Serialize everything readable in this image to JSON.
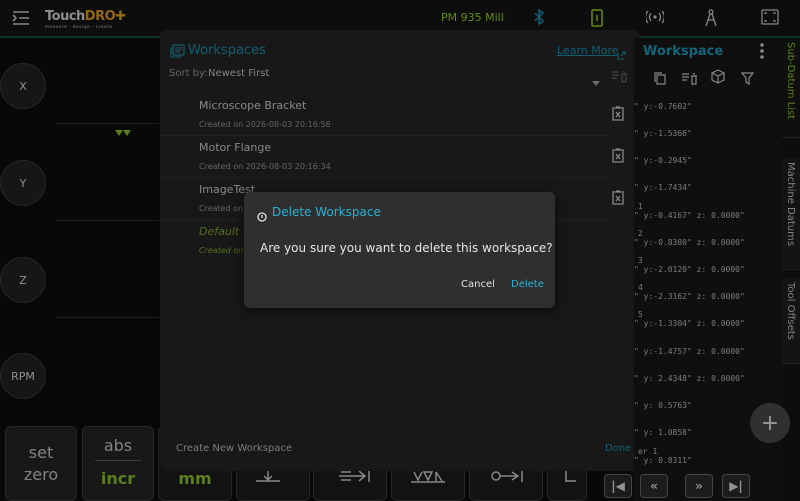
{
  "topbar": {
    "logo_main": "Touch",
    "logo_accent": "DRO",
    "logo_tag": "measure · design · create",
    "machine": "PM 935 Mill"
  },
  "axes": {
    "x": "X",
    "y": "Y",
    "z": "Z",
    "rpm": "RPM"
  },
  "bottom_buttons": {
    "set": "set",
    "zero": "zero",
    "abs": "abs",
    "incr": "incr",
    "mm": "mm"
  },
  "workspaces": {
    "title": "Workspaces",
    "learn_more": "Learn More",
    "sort_label": "Sort by:",
    "sort_value": "Newest First",
    "items": [
      {
        "name": "Microscope Bracket",
        "created": "Created on 2026-08-03 20:16:56"
      },
      {
        "name": "Motor Flange",
        "created": "Created on 2026-08-03 20:16:34"
      },
      {
        "name": "ImageTest",
        "created": "Created on 2"
      },
      {
        "name": "Default Wo",
        "created": "Created on 2"
      }
    ],
    "create_new": "Create New Workspace",
    "done": "Done"
  },
  "right_panel": {
    "title": "Workspace",
    "rows": [
      {
        "idx": "",
        "text": "\" y:-0.7602\""
      },
      {
        "idx": "",
        "text": "\" y:-1.5366\""
      },
      {
        "idx": "",
        "text": "\" y:-0.2945\""
      },
      {
        "idx": "",
        "text": "\" y:-1.7434\""
      },
      {
        "idx": "1",
        "text": "\" y:-0.4167\" z: 0.0000\""
      },
      {
        "idx": "2",
        "text": "\" y:-0.8380\" z: 0.0000\""
      },
      {
        "idx": "3",
        "text": "\" y:-2.0120\" z: 0.0000\""
      },
      {
        "idx": "4",
        "text": "\" y:-2.3162\" z: 0.0000\""
      },
      {
        "idx": "5",
        "text": "\" y:-1.3304\" z: 0.0000\""
      },
      {
        "idx": "",
        "text": "\" y:-1.4757\" z: 0.0000\""
      },
      {
        "idx": "",
        "text": "\" y: 2.4348\" z: 0.0000\""
      },
      {
        "idx": "",
        "text": "\" y: 0.5763\""
      },
      {
        "idx": "",
        "text": "\" y: 1.0858\""
      },
      {
        "idx": "er 1",
        "text": "\" y: 0.8311\""
      }
    ]
  },
  "side_tabs": {
    "sub_datum": "Sub-Datum List",
    "machine_datums": "Machine Datums",
    "tool_offsets": "Tool Offsets"
  },
  "dialog": {
    "title": "Delete Workspace",
    "message": "Are you sure you want to delete this workspace?",
    "cancel": "Cancel",
    "delete": "Delete"
  },
  "colors": {
    "accent_blue": "#27b3d6",
    "accent_green": "#8cc22f",
    "logo_orange": "#e0a020"
  }
}
